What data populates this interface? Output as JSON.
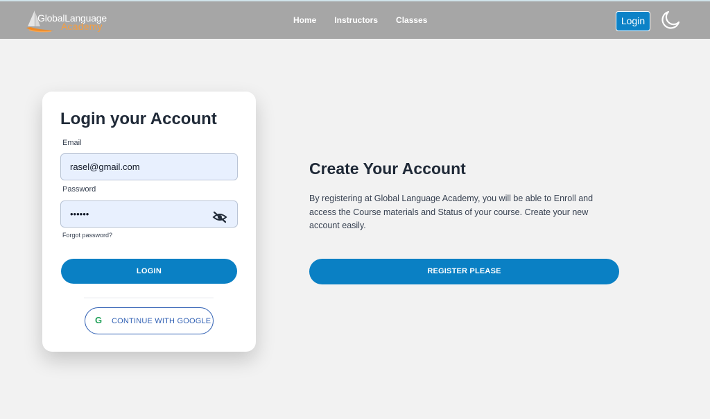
{
  "navbar": {
    "logo_line1": "GlobalLanguage",
    "logo_line2": "Academy",
    "links": [
      "Home",
      "Instructors",
      "Classes"
    ],
    "login_label": "Login",
    "theme_icon": "moon-icon"
  },
  "login_card": {
    "title": "Login your Account",
    "email_label": "Email",
    "email_value": "rasel@gmail.com",
    "password_label": "Password",
    "password_value": "••••••",
    "forgot_label": "Forgot password?",
    "login_button": "LOGIN",
    "google_icon": "google-icon",
    "google_button": "CONTINUE WITH GOOGLE"
  },
  "register": {
    "title": "Create Your Account",
    "text": "By registering at Global Language Academy, you will be able to Enroll and access the Course materials and Status of your course. Create your new account easily.",
    "button": "REGISTER PLEASE"
  },
  "colors": {
    "navbar": "#a6a6a6",
    "primary": "#0a80c4",
    "background": "#f2f2f2",
    "input_bg": "#e8f0fe",
    "logo_accent": "#f59e42"
  }
}
